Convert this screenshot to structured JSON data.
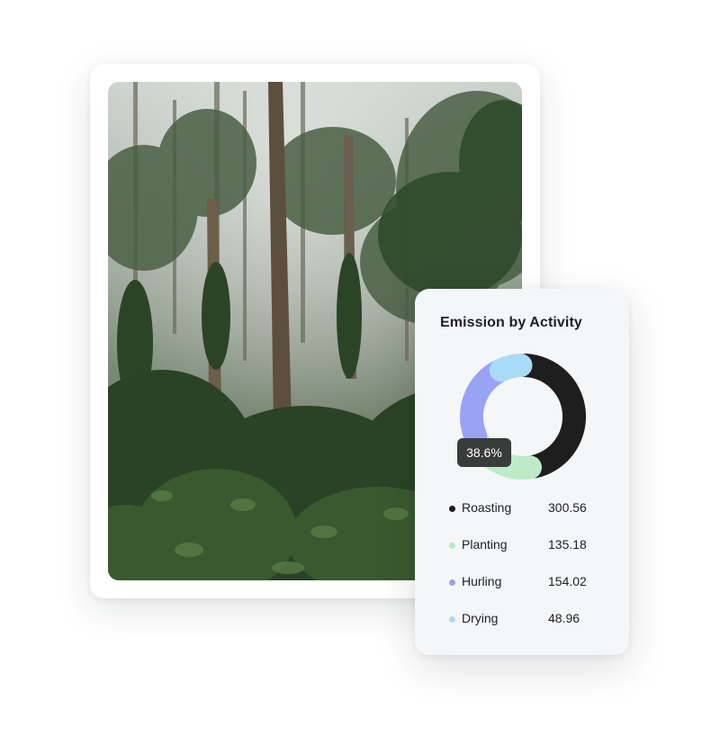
{
  "chart_data": {
    "type": "pie",
    "title": "Emission by Activity",
    "categories": [
      "Roasting",
      "Planting",
      "Hurling",
      "Drying"
    ],
    "values": [
      300.56,
      135.18,
      154.02,
      48.96
    ],
    "value_labels": [
      "300.56",
      "135.18",
      "154.02",
      "48.96"
    ],
    "colors": [
      "#1e1e1e",
      "#bdeac7",
      "#98a3f5",
      "#a9dbf7"
    ],
    "donut": true,
    "tooltip": {
      "category": "Planting",
      "text": "38.6%"
    }
  },
  "photo": {
    "icon": "forest-photo",
    "colors": {
      "sky": "#b7bfb8",
      "foliage": "#2f4a2b",
      "trunk": "#5e4e3e"
    }
  }
}
